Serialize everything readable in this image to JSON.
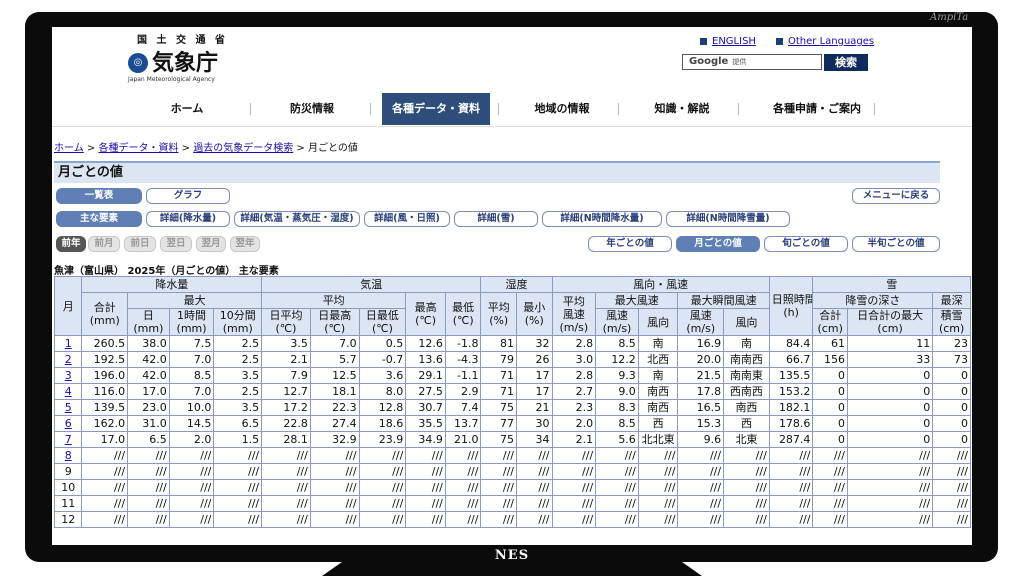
{
  "frame": {
    "label": "NES",
    "signature": "AmpiTa"
  },
  "header": {
    "ministry": "国 土 交 通 省",
    "logo_text": "気象庁",
    "logo_sub": "Japan Meteorological Agency",
    "lang_english": "ENGLISH",
    "lang_other": "Other Languages",
    "search_brand": "Google",
    "search_provider": "提供",
    "search_button": "検索"
  },
  "nav": [
    {
      "label": "ホーム"
    },
    {
      "label": "防災情報"
    },
    {
      "label": "各種データ・資料",
      "active": true
    },
    {
      "label": "地域の情報"
    },
    {
      "label": "知識・解説"
    },
    {
      "label": "各種申請・ご案内"
    }
  ],
  "breadcrumb": {
    "home": "ホーム",
    "sep": ">",
    "data": "各種データ・資料",
    "past": "過去の気象データ検索",
    "current": "月ごとの値"
  },
  "page_title": "月ごとの値",
  "view_buttons": {
    "table": "一覧表",
    "graph": "グラフ",
    "back_menu": "メニューに戻る"
  },
  "element_buttons": [
    {
      "label": "主な要素",
      "active": true
    },
    {
      "label": "詳細(降水量)"
    },
    {
      "label": "詳細(気温・蒸気圧・湿度)"
    },
    {
      "label": "詳細(風・日照)"
    },
    {
      "label": "詳細(雪)"
    },
    {
      "label": "詳細(N時間降水量)"
    },
    {
      "label": "詳細(N時間降雪量)"
    }
  ],
  "period_buttons": [
    {
      "label": "前年",
      "state": "enabled"
    },
    {
      "label": "前月",
      "state": "disabled"
    },
    {
      "label": "前日",
      "state": "disabled"
    },
    {
      "label": "翌日",
      "state": "disabled"
    },
    {
      "label": "翌月",
      "state": "disabled"
    },
    {
      "label": "翌年",
      "state": "disabled"
    }
  ],
  "interval_buttons": [
    {
      "label": "年ごとの値"
    },
    {
      "label": "月ごとの値",
      "active": true
    },
    {
      "label": "旬ごとの値"
    },
    {
      "label": "半旬ごとの値"
    }
  ],
  "station_title": "魚津（富山県） 2025年（月ごとの値） 主な要素",
  "table": {
    "h_month": "月",
    "h_precip": "降水量",
    "h_temp": "気温",
    "h_humid": "湿度",
    "h_wind": "風向・風速",
    "h_sun": "日照時間",
    "h_sun_unit": "(h)",
    "h_snow": "雪",
    "h_total": "合計",
    "h_total_unit": "(mm)",
    "h_max": "最大",
    "h_day": "日",
    "h_1h": "1時間",
    "h_10m": "10分間",
    "h_mm": "(mm)",
    "h_avg": "平均",
    "h_tmean": "日平均",
    "h_tmaxmean": "日最高",
    "h_tminmean": "日最低",
    "h_tmax": "最高",
    "h_tmin": "最低",
    "h_degc": "(℃)",
    "h_havg": "平均",
    "h_hmin": "最小",
    "h_pct": "(%)",
    "h_wavg": "平均",
    "h_wavg2": "風速",
    "h_ms": "(m/s)",
    "h_wmax": "最大風速",
    "h_wgust": "最大瞬間風速",
    "h_speed": "風速",
    "h_dir": "風向",
    "h_snowdepth": "降雪の深さ",
    "h_snowsum": "合計",
    "h_snowdaymax": "日合計の最大",
    "h_cm": "(cm)",
    "h_maxdepth": "最深",
    "h_maxdepth2": "積雪",
    "rows": [
      {
        "m": "1",
        "link": true,
        "v": [
          "260.5",
          "38.0",
          "7.5",
          "2.5",
          "3.5",
          "7.0",
          "0.5",
          "12.6",
          "-1.8",
          "81",
          "32",
          "2.8",
          "8.5",
          "南",
          "16.9",
          "南",
          "84.4",
          "61",
          "11",
          "23"
        ]
      },
      {
        "m": "2",
        "link": true,
        "v": [
          "192.5",
          "42.0",
          "7.0",
          "2.5",
          "2.1",
          "5.7",
          "-0.7",
          "13.6",
          "-4.3",
          "79",
          "26",
          "3.0",
          "12.2",
          "北西",
          "20.0",
          "南南西",
          "66.7",
          "156",
          "33",
          "73"
        ]
      },
      {
        "m": "3",
        "link": true,
        "v": [
          "196.0",
          "42.0",
          "8.5",
          "3.5",
          "7.9",
          "12.5",
          "3.6",
          "29.1",
          "-1.1",
          "71",
          "17",
          "2.8",
          "9.3",
          "南",
          "21.5",
          "南南東",
          "135.5",
          "0",
          "0",
          "0"
        ]
      },
      {
        "m": "4",
        "link": true,
        "v": [
          "116.0",
          "17.0",
          "7.0",
          "2.5",
          "12.7",
          "18.1",
          "8.0",
          "27.5",
          "2.9",
          "71",
          "17",
          "2.7",
          "9.0",
          "南西",
          "17.8",
          "西南西",
          "153.2",
          "0",
          "0",
          "0"
        ]
      },
      {
        "m": "5",
        "link": true,
        "v": [
          "139.5",
          "23.0",
          "10.0",
          "3.5",
          "17.2",
          "22.3",
          "12.8",
          "30.7",
          "7.4",
          "75",
          "21",
          "2.3",
          "8.3",
          "南西",
          "16.5",
          "南西",
          "182.1",
          "0",
          "0",
          "0"
        ]
      },
      {
        "m": "6",
        "link": true,
        "v": [
          "162.0",
          "31.0",
          "14.5",
          "6.5",
          "22.8",
          "27.4",
          "18.6",
          "35.5",
          "13.7",
          "77",
          "30",
          "2.0",
          "8.5",
          "西",
          "15.3",
          "西",
          "178.6",
          "0",
          "0",
          "0"
        ]
      },
      {
        "m": "7",
        "link": true,
        "v": [
          "17.0",
          "6.5",
          "2.0",
          "1.5",
          "28.1",
          "32.9",
          "23.9",
          "34.9",
          "21.0",
          "75",
          "34",
          "2.1",
          "5.6",
          "北北東",
          "9.6",
          "北東",
          "287.4",
          "0",
          "0",
          "0"
        ]
      },
      {
        "m": "8",
        "link": true,
        "v": [
          "///",
          "///",
          "///",
          "///",
          "///",
          "///",
          "///",
          "///",
          "///",
          "///",
          "///",
          "///",
          "///",
          "///",
          "///",
          "///",
          "///",
          "///",
          "///",
          "///"
        ]
      },
      {
        "m": "9",
        "link": false,
        "v": [
          "///",
          "///",
          "///",
          "///",
          "///",
          "///",
          "///",
          "///",
          "///",
          "///",
          "///",
          "///",
          "///",
          "///",
          "///",
          "///",
          "///",
          "///",
          "///",
          "///"
        ]
      },
      {
        "m": "10",
        "link": false,
        "v": [
          "///",
          "///",
          "///",
          "///",
          "///",
          "///",
          "///",
          "///",
          "///",
          "///",
          "///",
          "///",
          "///",
          "///",
          "///",
          "///",
          "///",
          "///",
          "///",
          "///"
        ]
      },
      {
        "m": "11",
        "link": false,
        "v": [
          "///",
          "///",
          "///",
          "///",
          "///",
          "///",
          "///",
          "///",
          "///",
          "///",
          "///",
          "///",
          "///",
          "///",
          "///",
          "///",
          "///",
          "///",
          "///",
          "///"
        ]
      },
      {
        "m": "12",
        "link": false,
        "v": [
          "///",
          "///",
          "///",
          "///",
          "///",
          "///",
          "///",
          "///",
          "///",
          "///",
          "///",
          "///",
          "///",
          "///",
          "///",
          "///",
          "///",
          "///",
          "///",
          "///"
        ]
      }
    ]
  }
}
